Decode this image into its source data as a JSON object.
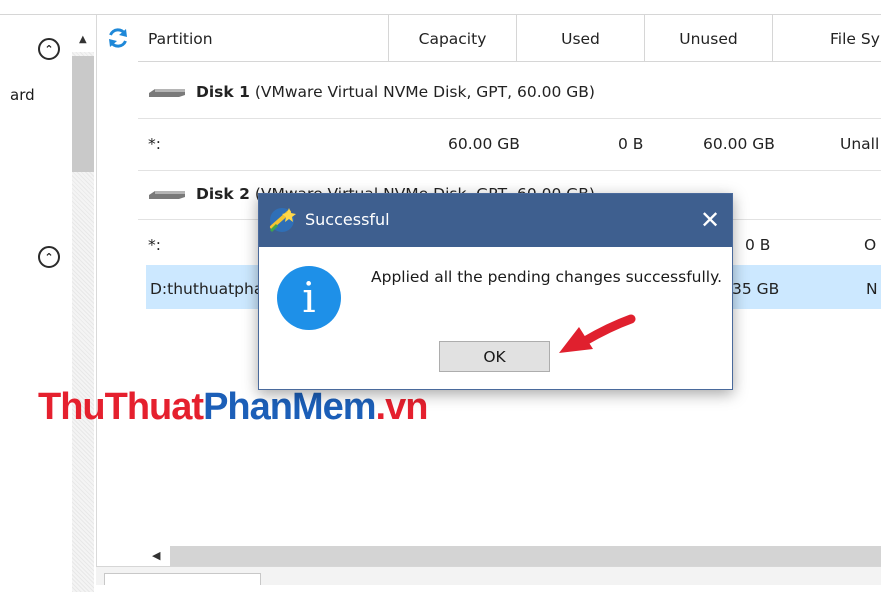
{
  "left_panel": {
    "truncated_label": "ard",
    "collapse_top": "⌃",
    "collapse_bottom": "⌃"
  },
  "table": {
    "columns": [
      "Partition",
      "Capacity",
      "Used",
      "Unused",
      "File Sy"
    ],
    "disk1": {
      "name": "Disk 1",
      "details": "(VMware Virtual NVMe Disk, GPT, 60.00 GB)"
    },
    "disk1_rows": [
      {
        "partition": "*:",
        "capacity": "60.00 GB",
        "used": "0 B",
        "unused": "60.00 GB",
        "fs": "Unall"
      }
    ],
    "disk2": {
      "name": "Disk 2",
      "details": "(VMware Virtual NVMe Disk, GPT, 60.00 GB)"
    },
    "disk2_rows": [
      {
        "partition": "*:",
        "used": "0 B",
        "fs": "O"
      },
      {
        "partition": "D:thuthuatpha",
        "unused": "35 GB",
        "fs": "N"
      }
    ]
  },
  "watermark": {
    "part1": "ThuThuat",
    "part2": "PhanMem",
    "part3": ".vn"
  },
  "dialog": {
    "title": "Successful",
    "message": "Applied all the pending changes successfully.",
    "ok_label": "OK",
    "close_glyph": "✕",
    "info_glyph": "i"
  },
  "colors": {
    "titlebar": "#3e5f8f",
    "info_icon": "#1e90e8",
    "selection": "#cce8ff",
    "arrow": "#e0202e"
  }
}
